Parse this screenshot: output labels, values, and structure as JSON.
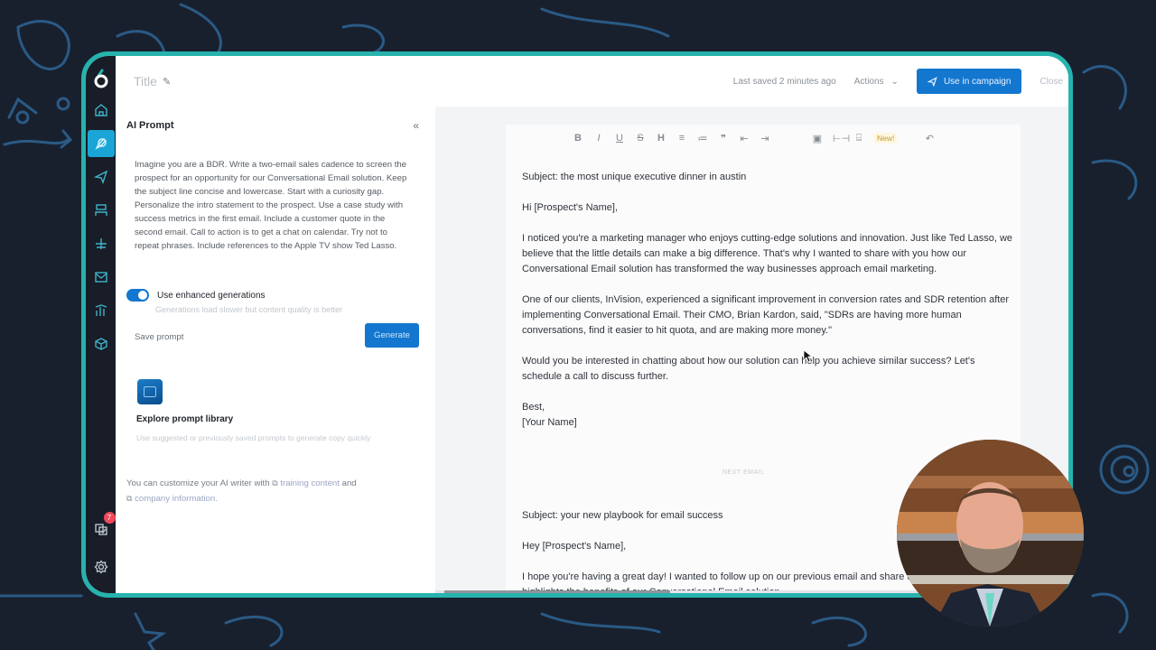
{
  "app": {
    "title": "Title",
    "last_saved": "Last saved 2 minutes ago",
    "actions_label": "Actions",
    "use_in_campaign_label": "Use in campaign",
    "close_label": "Close",
    "accent_color": "#1377cf",
    "frame_color": "#27b3ad"
  },
  "sidebar": {
    "items": [
      {
        "icon": "home-icon",
        "active": false
      },
      {
        "icon": "ai-writer-icon",
        "active": true
      },
      {
        "icon": "send-icon",
        "active": false
      },
      {
        "icon": "contacts-icon",
        "active": false
      },
      {
        "icon": "workflow-icon",
        "active": false
      },
      {
        "icon": "mail-icon",
        "active": false
      },
      {
        "icon": "analytics-icon",
        "active": false
      },
      {
        "icon": "integrations-icon",
        "active": false
      }
    ],
    "tasks_badge": "7"
  },
  "prompt_panel": {
    "title": "AI Prompt",
    "prompt_text": "Imagine you are a BDR. Write a two-email sales cadence to screen the prospect for an opportunity for our Conversational Email solution. Keep the subject line concise and lowercase. Start with a curiosity gap. Personalize the intro statement to the prospect. Use a case study with success metrics in the first email. Include a customer quote in the second email. Call to action is to get a chat on calendar. Try not to repeat phrases. Include references to the Apple TV show Ted Lasso.",
    "toggle_label": "Use enhanced generations",
    "toggle_on": true,
    "toggle_sub": "Generations load slower but content quality is better",
    "save_prompt_label": "Save prompt",
    "generate_label": "Generate",
    "library_title": "Explore prompt library",
    "library_sub": "Use suggested or previously saved prompts to generate copy quickly",
    "customize_prefix": "You can customize your AI writer with",
    "customize_link1": "training content",
    "customize_and": "and",
    "customize_link2": "company information."
  },
  "editor": {
    "toolbar": [
      "B",
      "I",
      "U",
      "S",
      "H",
      "≡",
      "≔",
      "❞",
      "⇤",
      "⇥",
      "▣",
      "⊢⊣",
      "⌸",
      "New!",
      "↶"
    ],
    "email1": {
      "subject": "Subject: the most unique executive dinner in austin",
      "greeting": "Hi [Prospect's Name],",
      "para1": "I noticed you're a marketing manager who enjoys cutting-edge solutions and innovation. Just like Ted Lasso, we believe that the little details can make a big difference. That's why I wanted to share with you how our Conversational Email solution has transformed the way businesses approach email marketing.",
      "para2": "One of our clients, InVision, experienced a significant improvement in conversion rates and SDR retention after implementing Conversational Email. Their CMO, Brian Kardon, said, \"SDRs are having more human conversations, find it easier to hit quota, and are making more money.\"",
      "para3": "Would you be interested in chatting about how our solution can help you achieve similar success? Let's schedule a call to discuss further.",
      "signoff": "Best,",
      "name": "[Your Name]"
    },
    "divider_label": "NEXT EMAIL",
    "email2": {
      "subject": "Subject: your new playbook for email success",
      "greeting": "Hey [Prospect's Name],",
      "para1": "I hope you're having a great day! I wanted to follow up on our previous email and share a quote that truly highlights the benefits of our Conversational Email solution."
    }
  }
}
